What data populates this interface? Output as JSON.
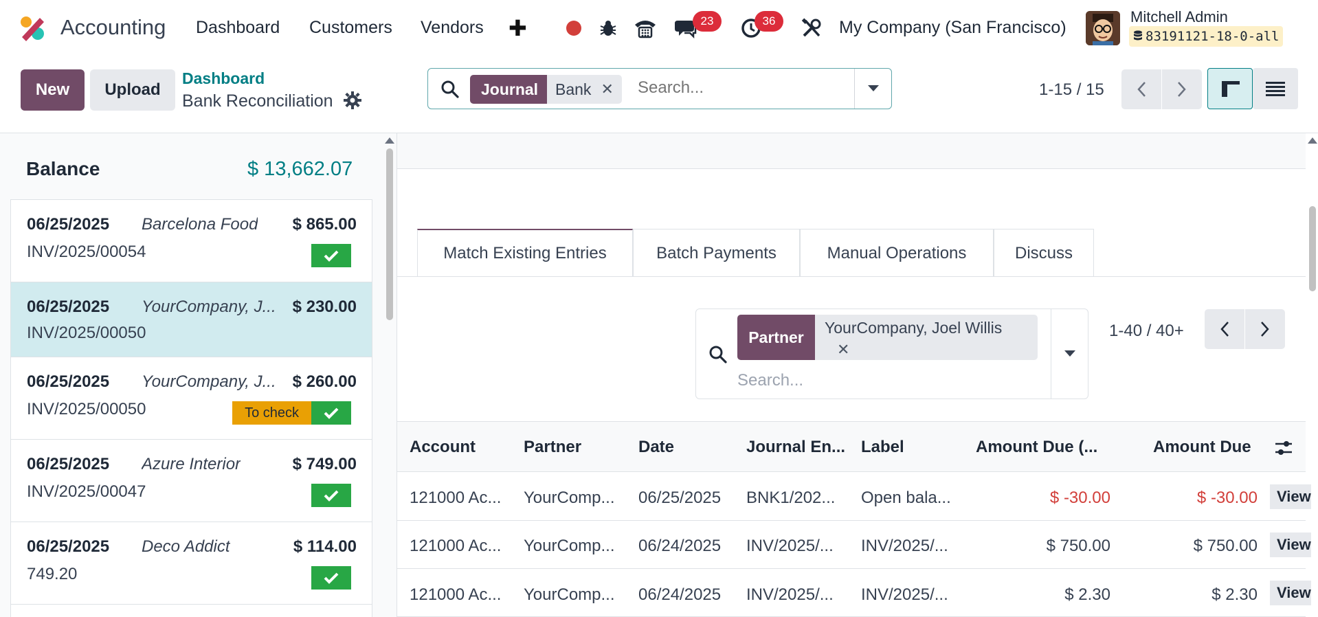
{
  "nav": {
    "app_name": "Accounting",
    "items": [
      "Dashboard",
      "Customers",
      "Vendors"
    ],
    "messages_count": "23",
    "activities_count": "36",
    "company": "My Company (San Francisco)",
    "user_name": "Mitchell Admin",
    "db_name": "83191121-18-0-all"
  },
  "control": {
    "new_label": "New",
    "upload_label": "Upload",
    "breadcrumb_parent": "Dashboard",
    "breadcrumb_current": "Bank Reconciliation",
    "facet_label": "Journal",
    "facet_value": "Bank",
    "search_placeholder": "Search...",
    "pager": "1-15 / 15"
  },
  "left": {
    "balance_label": "Balance",
    "balance_value": "$ 13,662.07",
    "statements": [
      {
        "date": "06/25/2025",
        "partner": "Barcelona Food",
        "amount": "$ 865.00",
        "ref": "INV/2025/00054",
        "to_check": false,
        "checked": true,
        "active": false
      },
      {
        "date": "06/25/2025",
        "partner": "YourCompany, J...",
        "amount": "$ 230.00",
        "ref": "INV/2025/00050",
        "to_check": false,
        "checked": false,
        "active": true
      },
      {
        "date": "06/25/2025",
        "partner": "YourCompany, J...",
        "amount": "$ 260.00",
        "ref": "INV/2025/00050",
        "to_check": true,
        "checked": true,
        "active": false
      },
      {
        "date": "06/25/2025",
        "partner": "Azure Interior",
        "amount": "$ 749.00",
        "ref": "INV/2025/00047",
        "to_check": false,
        "checked": true,
        "active": false
      },
      {
        "date": "06/25/2025",
        "partner": "Deco Addict",
        "amount": "$ 114.00",
        "ref": "749.20",
        "to_check": false,
        "checked": true,
        "active": false
      }
    ],
    "to_check_label": "To check"
  },
  "right": {
    "tabs": [
      "Match Existing Entries",
      "Batch Payments",
      "Manual Operations",
      "Discuss"
    ],
    "facet_label": "Partner",
    "facet_value": "YourCompany, Joel Willis",
    "search_placeholder": "Search...",
    "pager": "1-40 / 40+",
    "columns": [
      "Account",
      "Partner",
      "Date",
      "Journal En...",
      "Label",
      "Amount Due (...",
      "Amount Due"
    ],
    "rows": [
      {
        "account": "121000 Ac...",
        "partner": "YourComp...",
        "date": "06/25/2025",
        "journal": "BNK1/202...",
        "label": "Open bala...",
        "amount_due_cur": "$ -30.00",
        "amount_due": "$ -30.00",
        "negative": true
      },
      {
        "account": "121000 Ac...",
        "partner": "YourComp...",
        "date": "06/24/2025",
        "journal": "INV/2025/...",
        "label": "INV/2025/...",
        "amount_due_cur": "$ 750.00",
        "amount_due": "$ 750.00",
        "negative": false
      },
      {
        "account": "121000 Ac...",
        "partner": "YourComp...",
        "date": "06/24/2025",
        "journal": "INV/2025/...",
        "label": "INV/2025/...",
        "amount_due_cur": "$ 2.30",
        "amount_due": "$ 2.30",
        "negative": false
      }
    ],
    "view_label": "View"
  },
  "colors": {
    "brand": "#714b67",
    "teal": "#017e84",
    "success": "#28a745",
    "warning": "#e9a004",
    "danger": "#dc2c3a"
  }
}
